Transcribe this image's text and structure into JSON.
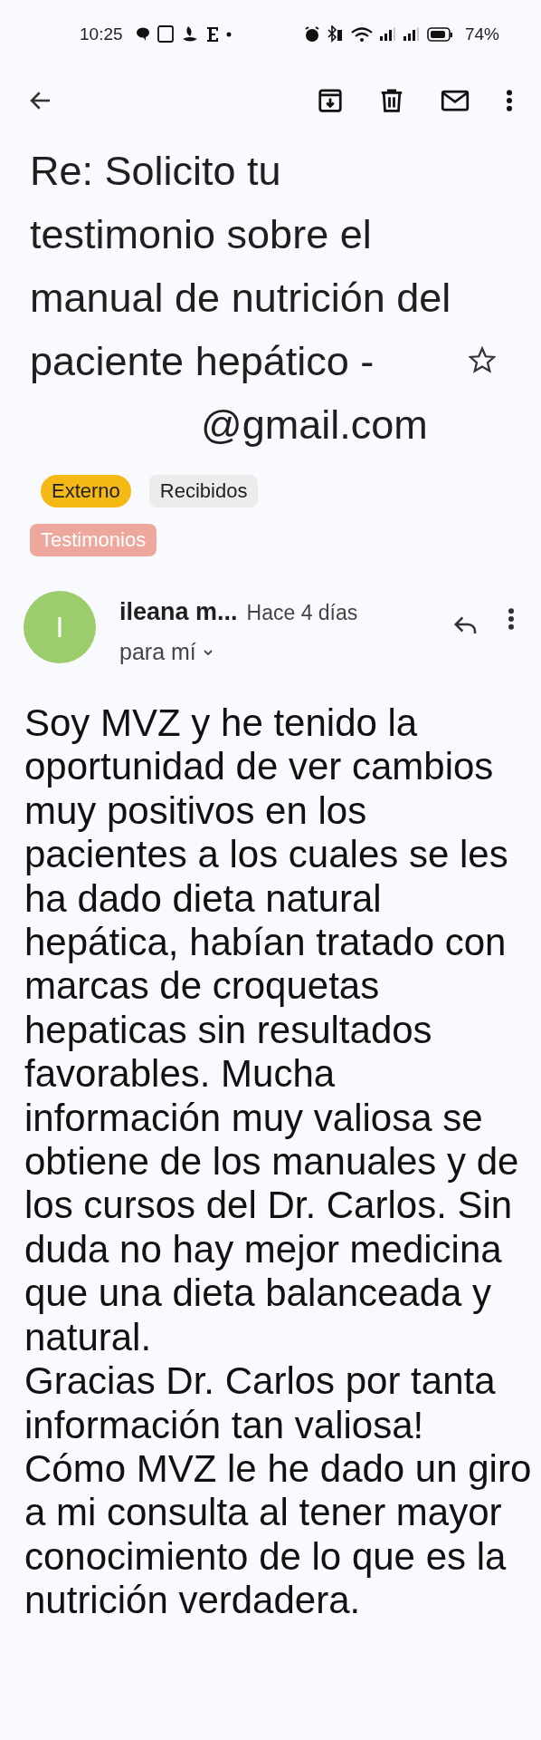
{
  "status_bar": {
    "time": "10:25",
    "battery": "74%"
  },
  "subject": {
    "text": "Re: Solicito tu testimonio sobre el manual de nutrición del paciente hepático -",
    "email_tail": "@gmail.com",
    "starred": false
  },
  "labels": [
    {
      "text": "Externo",
      "color": "#f5b915"
    },
    {
      "text": "Recibidos",
      "color": "#ececec"
    },
    {
      "text": "Testimonios",
      "color": "#eea79c"
    }
  ],
  "message": {
    "avatar_letter": "I",
    "sender": "ileana m...",
    "time": "Hace 4 días",
    "recipient": "para mí",
    "paragraphs": [
      "Soy MVZ y he tenido la oportunidad de ver cambios muy positivos en los pacientes a los cuales se les ha dado dieta natural hepática, habían tratado con marcas de croquetas hepaticas sin resultados favorables. Mucha información muy valiosa se obtiene de los manuales y de los cursos del Dr. Carlos. Sin duda no hay mejor medicina que una dieta balanceada y natural.",
      "Gracias Dr. Carlos por tanta información tan valiosa!",
      "Cómo MVZ le he dado un giro a mi consulta al tener mayor conocimiento de lo que es la nutrición verdadera."
    ]
  }
}
